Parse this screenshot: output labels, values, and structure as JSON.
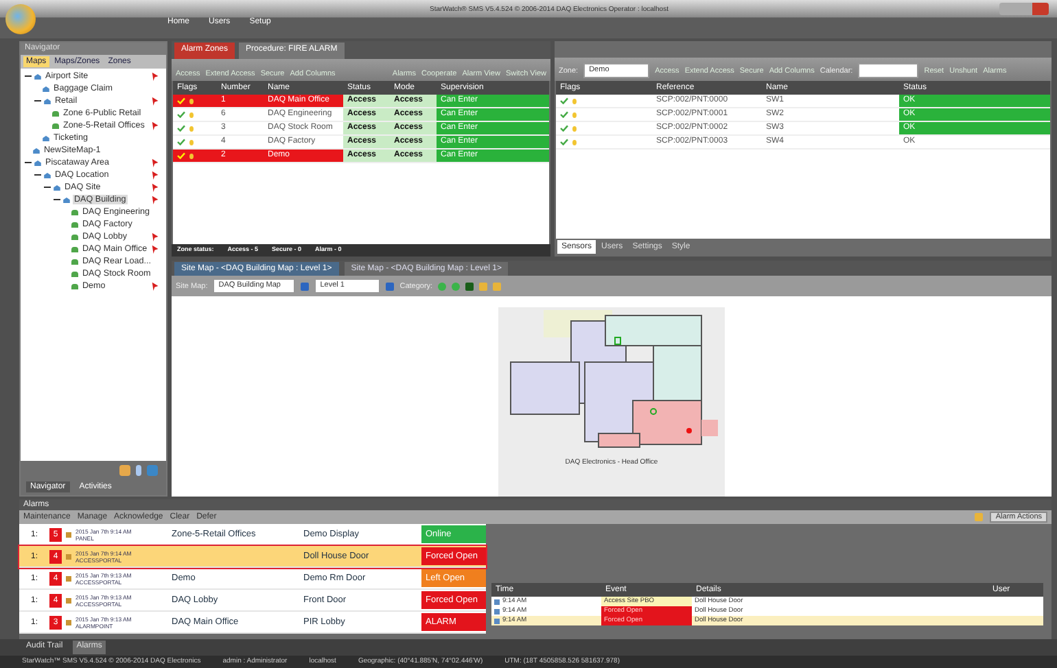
{
  "window": {
    "title": "StarWatch® SMS V5.4.524 © 2006-2014 DAQ Electronics Operator : localhost"
  },
  "ribbon_tabs": [
    "Home",
    "Users",
    "Setup"
  ],
  "navigator": {
    "title": "Navigator",
    "tabs": [
      {
        "label": "Maps",
        "selected": true
      },
      {
        "label": "Maps/Zones",
        "selected": false
      },
      {
        "label": "Zones",
        "selected": false
      }
    ],
    "tree": [
      {
        "label": "Airport Site",
        "kind": "area",
        "expanded": true,
        "flagged": true,
        "selected": false,
        "children": [
          {
            "label": "Baggage Claim",
            "kind": "area",
            "flagged": false,
            "selected": false
          },
          {
            "label": "Retail",
            "kind": "area",
            "expanded": true,
            "flagged": true,
            "selected": false,
            "children": [
              {
                "label": "Zone 6-Public Retail",
                "kind": "zone",
                "flagged": false,
                "selected": false
              },
              {
                "label": "Zone-5-Retail Offices",
                "kind": "zone",
                "flagged": true,
                "selected": false
              }
            ]
          },
          {
            "label": "Ticketing",
            "kind": "area",
            "flagged": false,
            "selected": false
          }
        ]
      },
      {
        "label": "NewSiteMap-1",
        "kind": "area",
        "flagged": false,
        "selected": false
      },
      {
        "label": "Piscataway Area",
        "kind": "area",
        "expanded": true,
        "flagged": true,
        "selected": false,
        "children": [
          {
            "label": "DAQ Location",
            "kind": "area",
            "expanded": true,
            "flagged": true,
            "selected": false,
            "children": [
              {
                "label": "DAQ Site",
                "kind": "area",
                "expanded": true,
                "flagged": true,
                "selected": false,
                "children": [
                  {
                    "label": "DAQ Building",
                    "kind": "area",
                    "expanded": true,
                    "flagged": true,
                    "selected": true,
                    "children": [
                      {
                        "label": "DAQ Engineering",
                        "kind": "zone",
                        "flagged": false,
                        "selected": false
                      },
                      {
                        "label": "DAQ Factory",
                        "kind": "zone",
                        "flagged": false,
                        "selected": false
                      },
                      {
                        "label": "DAQ Lobby",
                        "kind": "zone",
                        "flagged": true,
                        "selected": false
                      },
                      {
                        "label": "DAQ Main Office",
                        "kind": "zone",
                        "flagged": true,
                        "selected": false
                      },
                      {
                        "label": "DAQ Rear Load...",
                        "kind": "zone",
                        "flagged": false,
                        "selected": false
                      },
                      {
                        "label": "DAQ Stock Room",
                        "kind": "zone",
                        "flagged": false,
                        "selected": false
                      },
                      {
                        "label": "Demo",
                        "kind": "zone",
                        "flagged": true,
                        "selected": false
                      }
                    ]
                  }
                ]
              }
            ]
          }
        ]
      }
    ],
    "bottom_tabs": [
      {
        "label": "Navigator",
        "selected": true
      },
      {
        "label": "Activities",
        "selected": false
      }
    ]
  },
  "zone_panel": {
    "tabs": [
      {
        "label": "Alarm Zones",
        "selected": true
      },
      {
        "label": "Procedure: FIRE ALARM",
        "selected": false
      }
    ],
    "toolbar_left": [
      "Access",
      "Extend Access",
      "Secure",
      "Add Columns"
    ],
    "toolbar_right": [
      "Alarms",
      "Cooperate",
      "Alarm View",
      "Switch View"
    ],
    "columns": [
      "Flags",
      "Number",
      "Name",
      "Status",
      "Mode",
      "Supervision"
    ],
    "rows": [
      {
        "number": "1",
        "name": "DAQ Main Office",
        "status": "Access",
        "mode": "Access",
        "supervision": "Can Enter",
        "alarm": true
      },
      {
        "number": "6",
        "name": "DAQ Engineering",
        "status": "Access",
        "mode": "Access",
        "supervision": "Can Enter",
        "alarm": false
      },
      {
        "number": "3",
        "name": "DAQ Stock Room",
        "status": "Access",
        "mode": "Access",
        "supervision": "Can Enter",
        "alarm": false
      },
      {
        "number": "4",
        "name": "DAQ Factory",
        "status": "Access",
        "mode": "Access",
        "supervision": "Can Enter",
        "alarm": false
      },
      {
        "number": "2",
        "name": "Demo",
        "status": "Access",
        "mode": "Access",
        "supervision": "Can Enter",
        "alarm": true
      }
    ],
    "footer": [
      "Zone status:",
      "Access - 5",
      "Secure - 0",
      "Alarm - 0"
    ]
  },
  "sensor_panel": {
    "zone_label": "Zone:",
    "zone_value": "Demo",
    "toolbar_left": [
      "Access",
      "Extend Access",
      "Secure",
      "Add Columns"
    ],
    "calendar_label": "Calendar:",
    "toolbar_right": [
      "Reset",
      "Unshunt",
      "Alarms"
    ],
    "columns": [
      "Flags",
      "Reference",
      "Name",
      "Status"
    ],
    "rows": [
      {
        "reference": "SCP:002/PNT:0000",
        "name": "SW1",
        "status": "OK",
        "highlighted": true
      },
      {
        "reference": "SCP:002/PNT:0001",
        "name": "SW2",
        "status": "OK",
        "highlighted": true
      },
      {
        "reference": "SCP:002/PNT:0002",
        "name": "SW3",
        "status": "OK",
        "highlighted": true
      },
      {
        "reference": "SCP:002/PNT:0003",
        "name": "SW4",
        "status": "OK",
        "highlighted": false
      }
    ],
    "tabs": [
      {
        "label": "Sensors",
        "selected": true
      },
      {
        "label": "Users",
        "selected": false
      },
      {
        "label": "Settings",
        "selected": false
      },
      {
        "label": "Style",
        "selected": false
      }
    ]
  },
  "map_panel": {
    "tabs": [
      {
        "label": "Site Map - <DAQ Building Map : Level 1>",
        "selected": true
      },
      {
        "label": "Site Map - <DAQ Building Map : Level 1>",
        "selected": false
      }
    ],
    "site_map_label": "Site Map:",
    "site_map": "DAQ Building Map",
    "level": "Level 1",
    "category_label": "Category:",
    "caption": "DAQ Electronics - Head Office"
  },
  "alarms": {
    "title": "Alarms",
    "toolbar": [
      "Maintenance",
      "Manage",
      "Acknowledge",
      "Clear",
      "Defer"
    ],
    "actions_button": "Alarm Actions",
    "rows": [
      {
        "priority": "1:",
        "count": "5",
        "time": "2015 Jan 7th 9:14 AM",
        "type": "PANEL",
        "zone": "Zone-5-Retail Offices",
        "point": "Demo Display",
        "state": "Online",
        "color": "#2bb34a",
        "selected": false
      },
      {
        "priority": "1:",
        "count": "4",
        "time": "2015 Jan 7th 9:14 AM",
        "type": "ACCESSPORTAL",
        "zone": "",
        "point": "Doll House Door",
        "state": "Forced Open",
        "color": "#e3141c",
        "selected": true
      },
      {
        "priority": "1:",
        "count": "4",
        "time": "2015 Jan 7th 9:13 AM",
        "type": "ACCESSPORTAL",
        "zone": "Demo",
        "point": "Demo Rm Door",
        "state": "Left Open",
        "color": "#f07f1e",
        "selected": false
      },
      {
        "priority": "1:",
        "count": "4",
        "time": "2015 Jan 7th 9:13 AM",
        "type": "ACCESSPORTAL",
        "zone": "DAQ Lobby",
        "point": "Front Door",
        "state": "Forced Open",
        "color": "#e3141c",
        "selected": false
      },
      {
        "priority": "1:",
        "count": "3",
        "time": "2015 Jan 7th 9:13 AM",
        "type": "ALARMPOINT",
        "zone": "DAQ Main Office",
        "point": "PIR Lobby",
        "state": "ALARM",
        "color": "#e3141c",
        "selected": false
      }
    ],
    "event_columns": [
      "Time",
      "Event",
      "Details",
      "User"
    ],
    "events": [
      {
        "time": "9:14 AM",
        "event": "Access Site PBO",
        "details": "Doll House Door",
        "alert": false,
        "selected": false
      },
      {
        "time": "9:14 AM",
        "event": "Forced Open",
        "details": "Doll House Door",
        "alert": true,
        "selected": false
      },
      {
        "time": "9:14 AM",
        "event": "Forced Open",
        "details": "Doll House Door",
        "alert": true,
        "selected": true
      }
    ]
  },
  "bottom_tabs": [
    {
      "label": "Audit Trail",
      "selected": false
    },
    {
      "label": "Alarms",
      "selected": true
    }
  ],
  "status_bar": [
    "StarWatch™ SMS V5.4.524 © 2006-2014 DAQ Electronics",
    "admin : Administrator",
    "localhost",
    "Geographic: (40°41.885'N, 74°02.446'W)",
    "UTM: (18T 4505858.526 581637.978)"
  ]
}
